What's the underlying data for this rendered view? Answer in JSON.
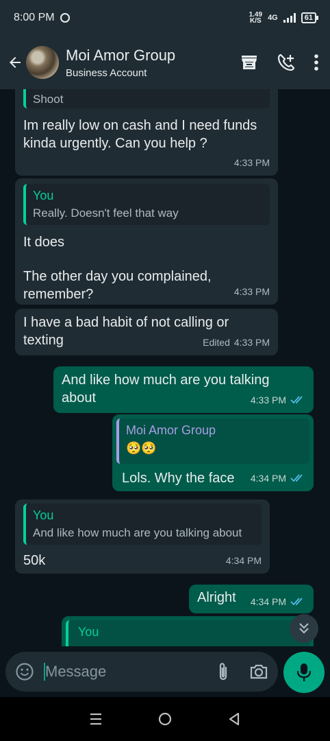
{
  "status_bar": {
    "time": "8:00 PM",
    "net_speed": "1.49",
    "net_unit": "K/S",
    "network": "4G",
    "battery": "61"
  },
  "header": {
    "title": "Moi Amor Group",
    "subtitle": "Business Account"
  },
  "messages": [
    {
      "dir": "in",
      "quote_text": "Shoot",
      "text": "Im really low on cash and I need funds kinda urgently. Can you help ?",
      "time": "4:33 PM"
    },
    {
      "dir": "in",
      "quote_name": "You",
      "quote_text": "Really. Doesn't feel that way",
      "text_line1": "It does",
      "text_line2": "The other day you complained, remember?",
      "time": "4:33 PM"
    },
    {
      "dir": "in",
      "text": "I have a bad habit of not calling or texting",
      "edited": "Edited",
      "time": "4:33 PM"
    },
    {
      "dir": "out",
      "text": "And like how much are you talking about",
      "time": "4:33 PM"
    },
    {
      "dir": "out",
      "quote_name": "Moi Amor Group",
      "quote_text": "🥺🥺",
      "text": "Lols. Why the face",
      "time": "4:34 PM"
    },
    {
      "dir": "in",
      "quote_name": "You",
      "quote_text": "And like how much are you talking about",
      "text": "50k",
      "time": "4:34 PM"
    },
    {
      "dir": "out",
      "text": "Alright",
      "time": "4:34 PM"
    },
    {
      "dir": "out",
      "quote_name": "You"
    }
  ],
  "composer": {
    "placeholder": "Message"
  },
  "colors": {
    "accent": "#00a884",
    "incoming": "#202c33",
    "outgoing": "#005c4b",
    "read_ticks": "#53bdeb"
  }
}
